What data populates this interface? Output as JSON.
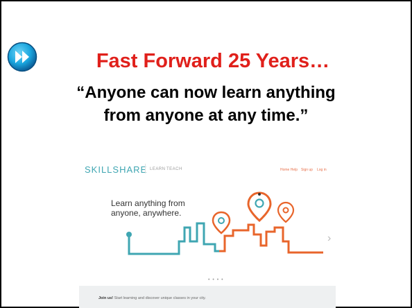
{
  "slide": {
    "title": "Fast Forward 25 Years…",
    "quote_line1": "“Anyone can now learn anything",
    "quote_line2": "from anyone at any time.”",
    "icon": "fast-forward-icon"
  },
  "screenshot": {
    "logo": "SKILLSHARE",
    "nav": {
      "learn": "LEARN",
      "teach": "TEACH"
    },
    "right_links": [
      "Home Help",
      "Sign up",
      "Log in"
    ],
    "hero_line1": "Learn anything from",
    "hero_line2": "anyone, anywhere.",
    "carousel_dots": "• • • •",
    "join_bold": "Join us!",
    "join_text": " Start learning and discover unique classes in your city.",
    "next_arrow": "›"
  },
  "colors": {
    "title": "#e0201b",
    "icon_blue": "#1aa6df",
    "teal": "#3fa6b2",
    "orange": "#e8652b",
    "join_bg": "#eef0f1"
  }
}
